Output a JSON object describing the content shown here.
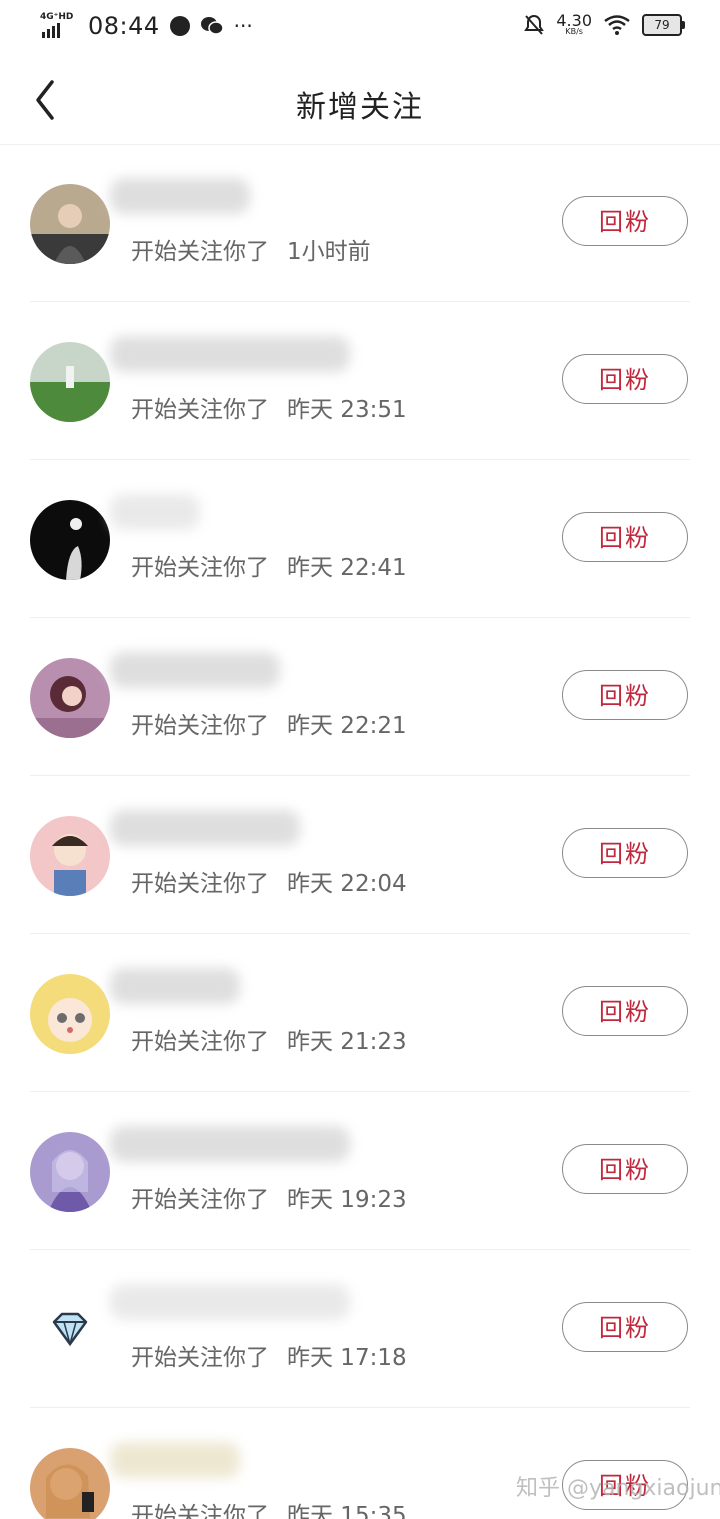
{
  "status_bar": {
    "network": "4G⁺HD",
    "time": "08:44",
    "speed": "4.30",
    "speed_unit": "KB/s",
    "battery": "79"
  },
  "header": {
    "title": "新增关注"
  },
  "follow_back_label": "回粉",
  "status_text": "开始关注你了",
  "followers": [
    {
      "when": "1小时前"
    },
    {
      "when": "昨天 23:51"
    },
    {
      "when": "昨天 22:41"
    },
    {
      "when": "昨天 22:21"
    },
    {
      "when": "昨天 22:04"
    },
    {
      "when": "昨天 21:23"
    },
    {
      "when": "昨天 19:23"
    },
    {
      "when": "昨天 17:18"
    },
    {
      "when": "昨天 15:35"
    }
  ],
  "watermark": "知乎 @yangxiaojun"
}
